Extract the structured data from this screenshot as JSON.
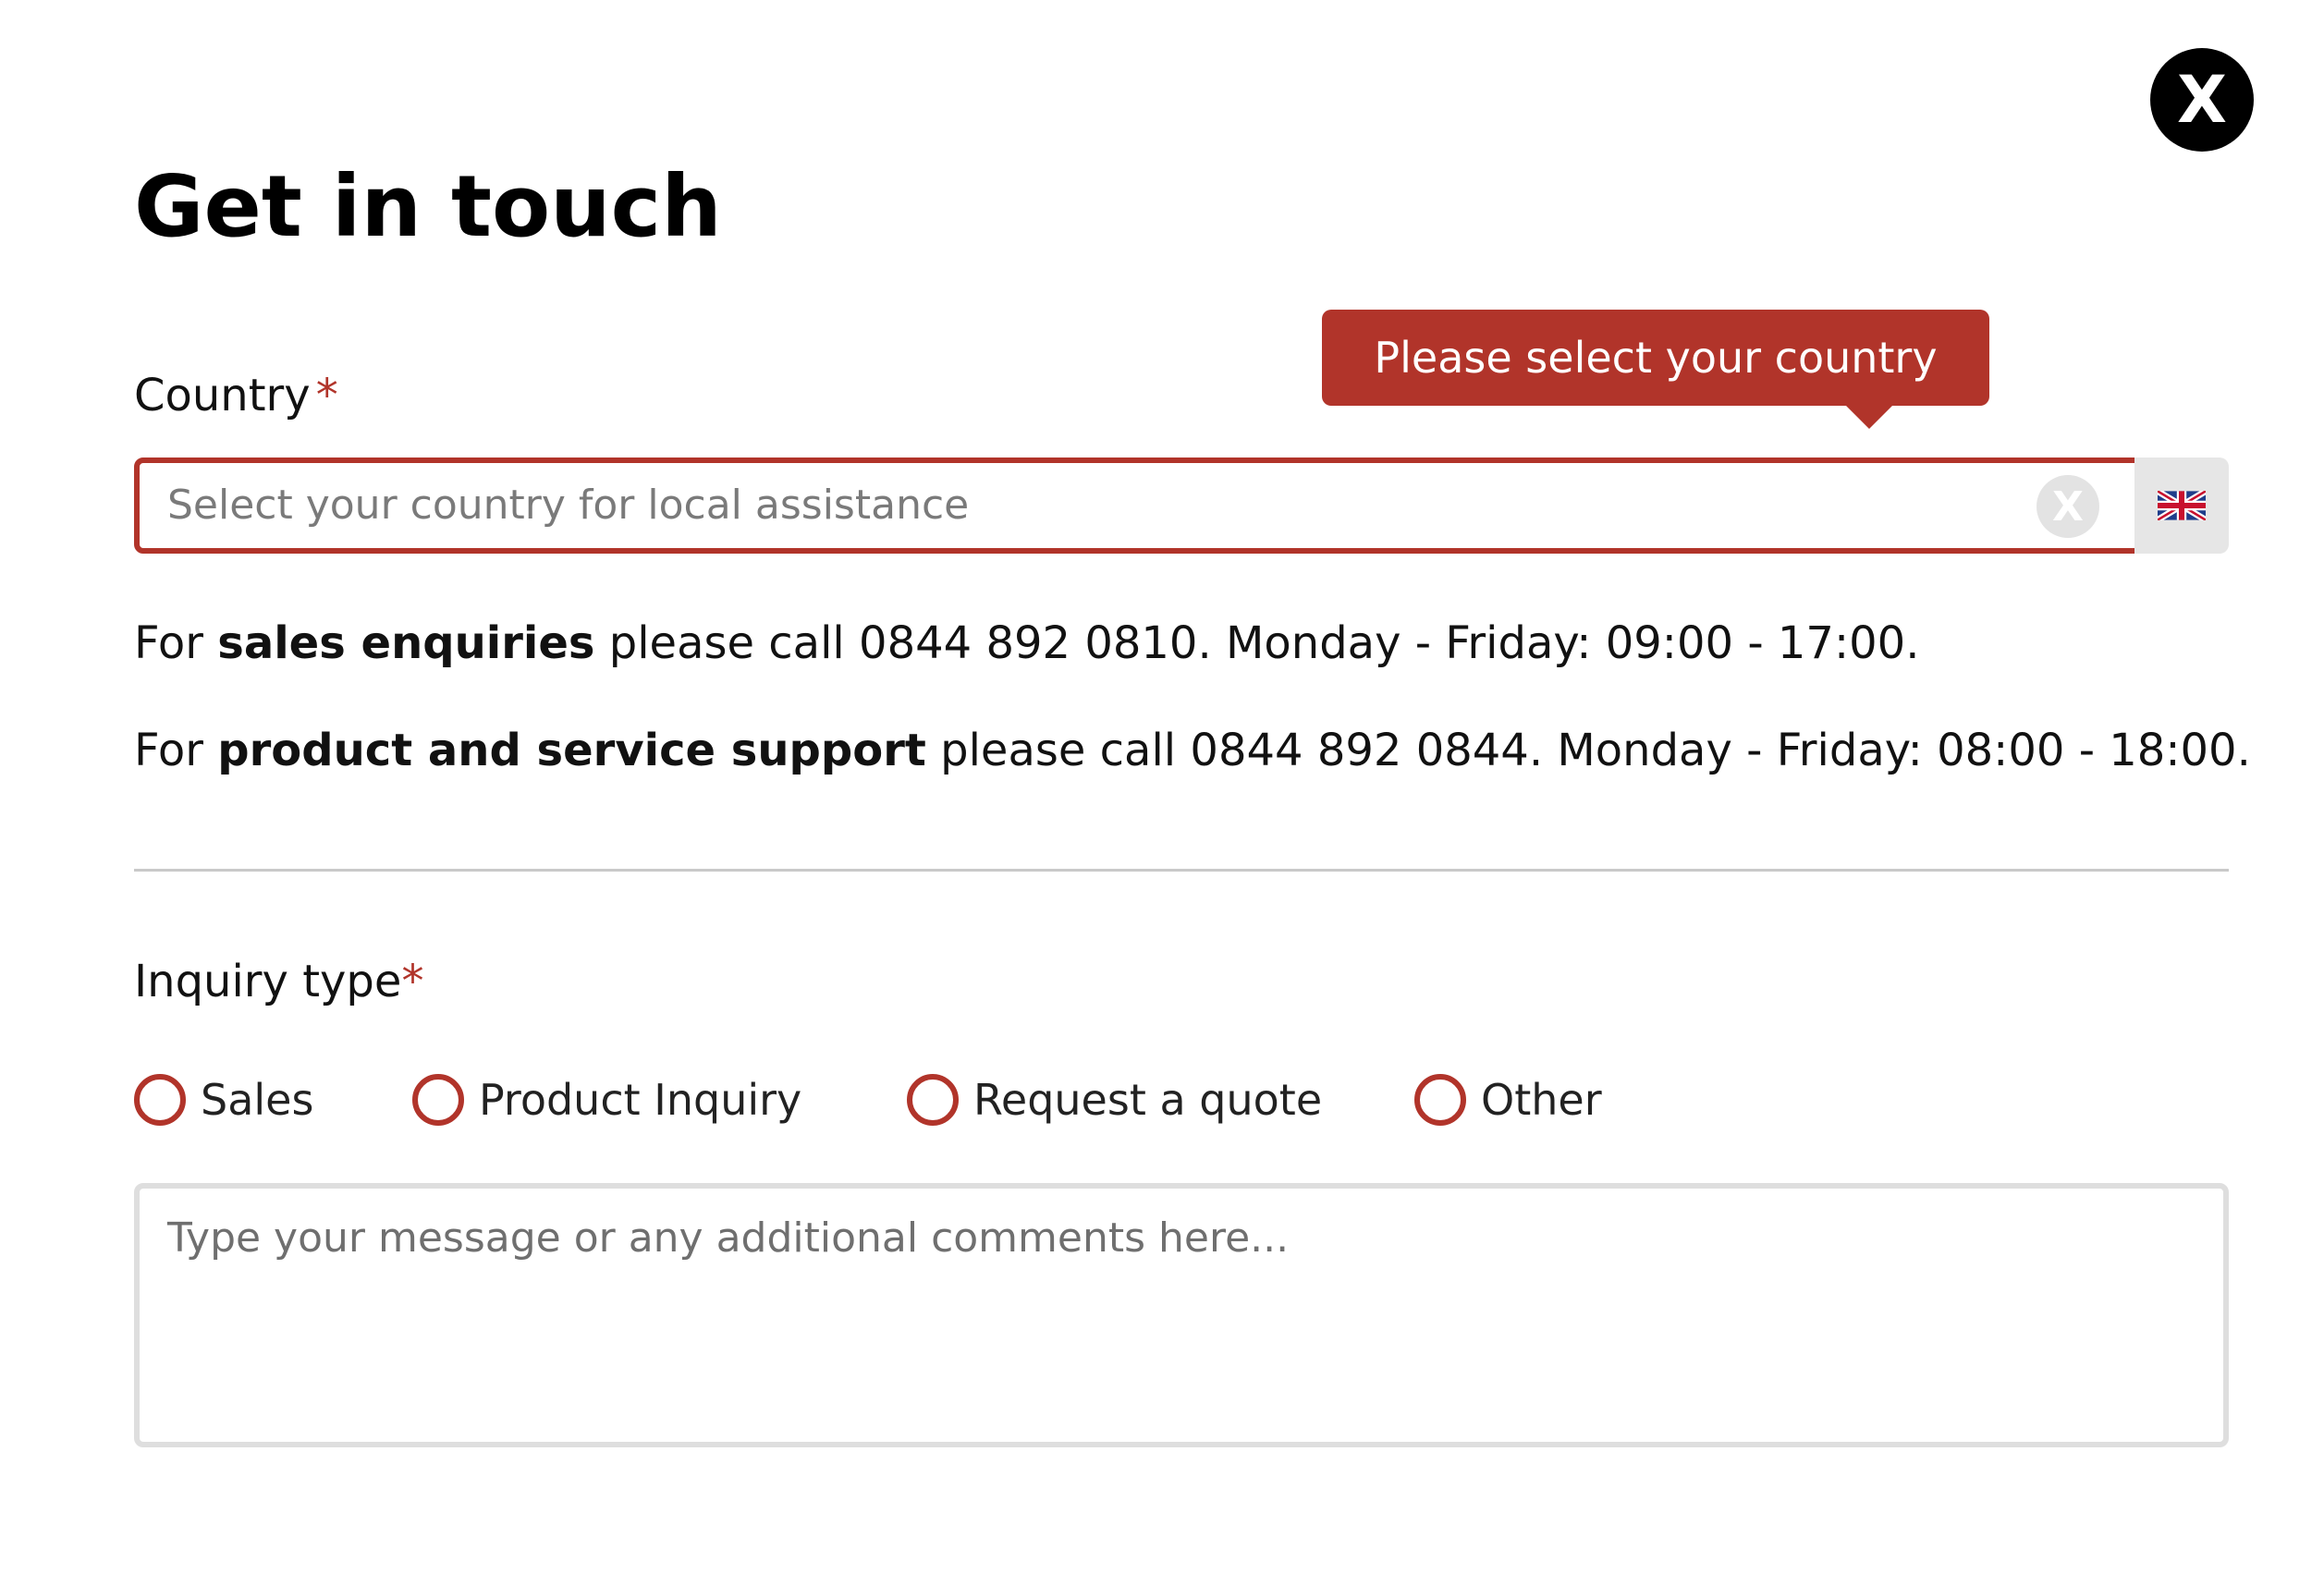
{
  "modal": {
    "close_label": "X",
    "title": "Get in touch"
  },
  "country": {
    "label": "Country",
    "required_mark": "*",
    "placeholder": "Select your country for local assistance",
    "clear_label": "X",
    "flag_icon": "uk-flag-icon",
    "tooltip": "Please select your country"
  },
  "info": {
    "sales": {
      "prefix": "For ",
      "bold": "sales enquiries",
      "suffix": " please call 0844 892 0810. Monday - Friday: 09:00 - 17:00."
    },
    "support": {
      "prefix": "For ",
      "bold": "product and service support",
      "suffix": " please call 0844 892 0844. Monday - Friday: 08:00 - 18:00."
    }
  },
  "inquiry": {
    "label": "Inquiry type",
    "required_mark": "*",
    "options": [
      "Sales",
      "Product Inquiry",
      "Request a quote",
      "Other"
    ]
  },
  "message": {
    "placeholder": "Type your message or any additional comments here..."
  },
  "colors": {
    "accent": "#b1342a",
    "close_bg": "#000000",
    "divider": "#c9c9c9",
    "field_border": "#dedede"
  }
}
